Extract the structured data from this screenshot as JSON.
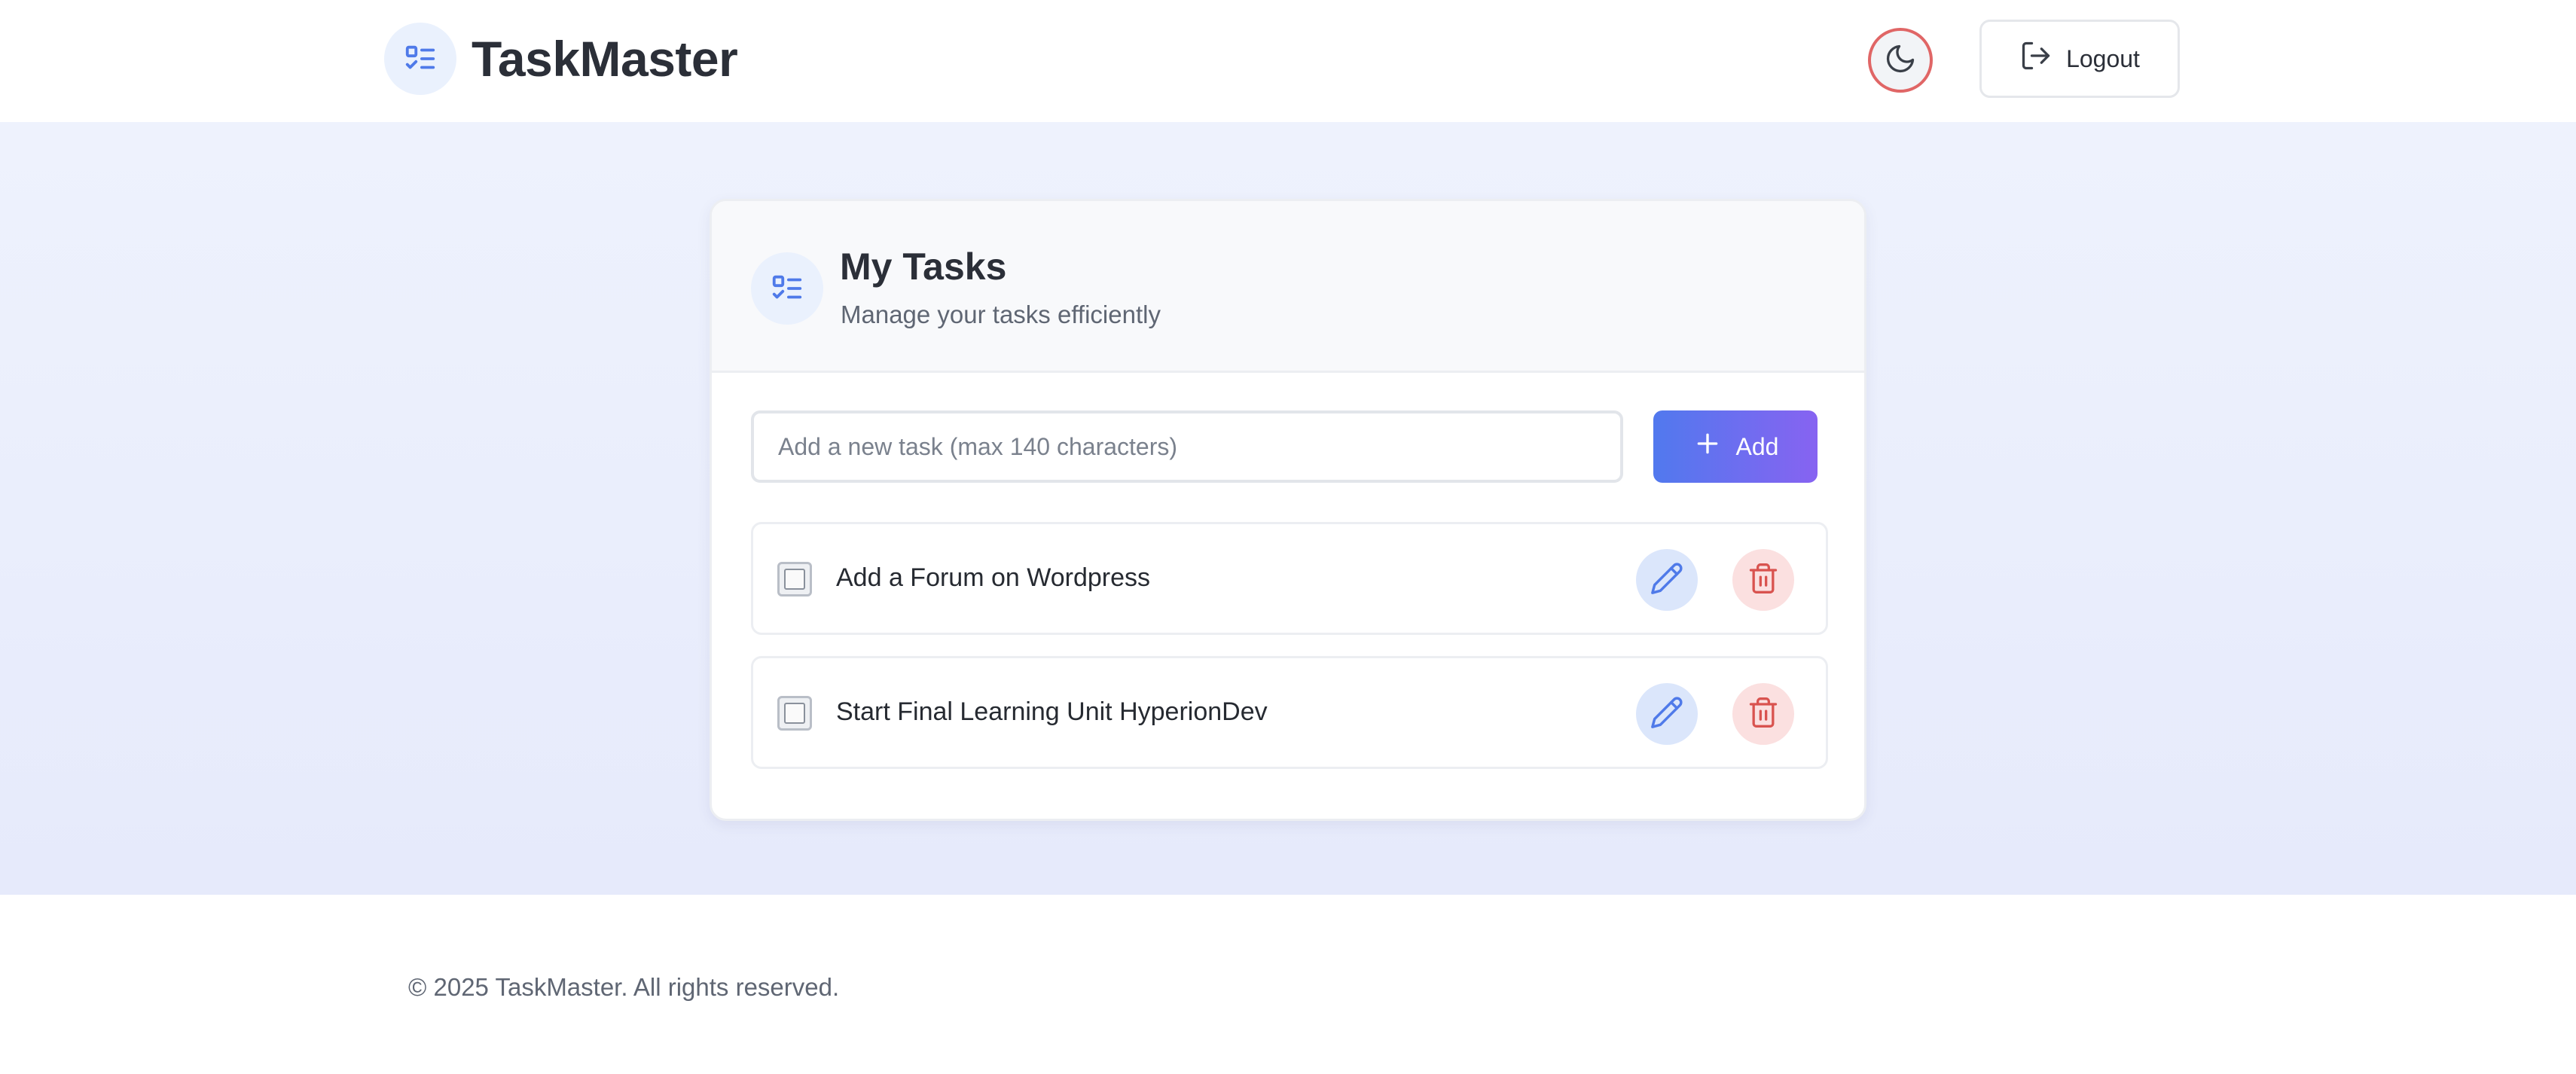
{
  "header": {
    "app_title": "TaskMaster",
    "brand_icon": "task-list-icon",
    "theme_toggle_icon": "moon-icon",
    "logout_label": "Logout",
    "logout_icon": "logout-icon"
  },
  "card": {
    "title": "My Tasks",
    "subtitle": "Manage your tasks efficiently",
    "icon": "task-list-icon"
  },
  "new_task": {
    "value": "",
    "placeholder": "Add a new task (max 140 characters)",
    "add_label": "Add",
    "add_icon": "plus-icon"
  },
  "tasks": [
    {
      "text": "Add a Forum on Wordpress",
      "completed": false
    },
    {
      "text": "Start Final Learning Unit HyperionDev",
      "completed": false
    }
  ],
  "footer": {
    "text": "© 2025 TaskMaster. All rights reserved."
  },
  "colors": {
    "accent_blue": "#4f7ae9",
    "gradient_start": "#5179ee",
    "gradient_end": "#8763f1",
    "danger_red": "#d9534f",
    "theme_toggle_border": "#e06666",
    "main_background": "#eef2fd"
  }
}
